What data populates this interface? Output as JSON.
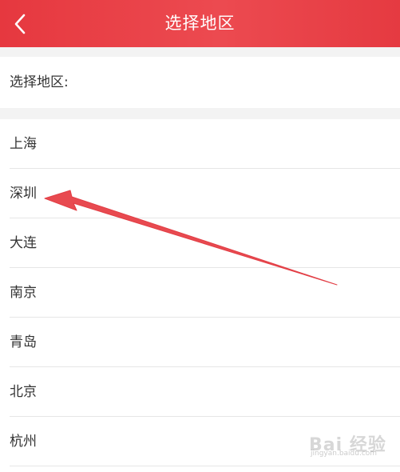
{
  "header": {
    "title": "选择地区",
    "back_icon": "chevron-left-icon",
    "color": "#e8404a"
  },
  "section": {
    "label": "选择地区:"
  },
  "regions": [
    {
      "label": "上海"
    },
    {
      "label": "深圳"
    },
    {
      "label": "大连"
    },
    {
      "label": "南京"
    },
    {
      "label": "青岛"
    },
    {
      "label": "北京"
    },
    {
      "label": "杭州"
    }
  ],
  "annotation": {
    "icon": "red-arrow-pointer",
    "color": "#e84a50",
    "target": "深圳"
  },
  "watermark": {
    "text": "Bai 经验",
    "sub": "jingyan.baidu.com"
  }
}
